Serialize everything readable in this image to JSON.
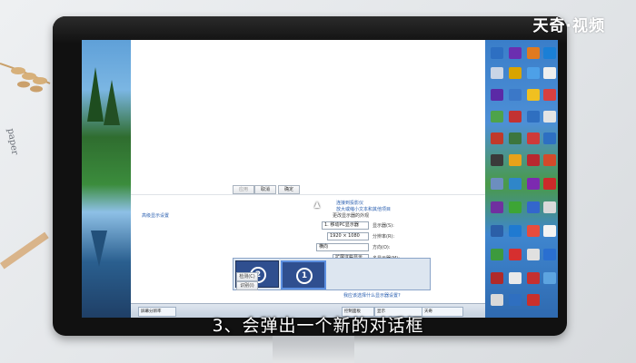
{
  "logo": {
    "text": "天奇·视频"
  },
  "subtitle": {
    "text": "3、会弹出一个新的对话框"
  },
  "dialog": {
    "top_buttons": [
      "应用",
      "取消",
      "确定"
    ],
    "links": [
      "高级显示设置",
      "连接到投影仪",
      "放大或缩小文本和其他项目",
      "我应该选择什么显示器设置?"
    ],
    "section_title": "更改显示器的外观",
    "rows": [
      {
        "label": "显示器(S):",
        "value": "1. 移动PC显示器"
      },
      {
        "label": "分辨率(R):",
        "value": "1920 × 1080"
      },
      {
        "label": "方向(O):",
        "value": "横向"
      },
      {
        "label": "多显示器(M):",
        "value": "扩展这些显示"
      }
    ],
    "side_buttons": [
      "检测(C)",
      "识别(I)"
    ],
    "monitors": [
      "1",
      "2"
    ]
  },
  "taskbar": {
    "items": [
      "屏幕分辨率",
      "控制面板",
      "显示",
      "天奇"
    ]
  },
  "colors": {
    "screen_bezel": "#111111",
    "link": "#2a5fb0",
    "monitor_tile": "#2f4f8f"
  }
}
